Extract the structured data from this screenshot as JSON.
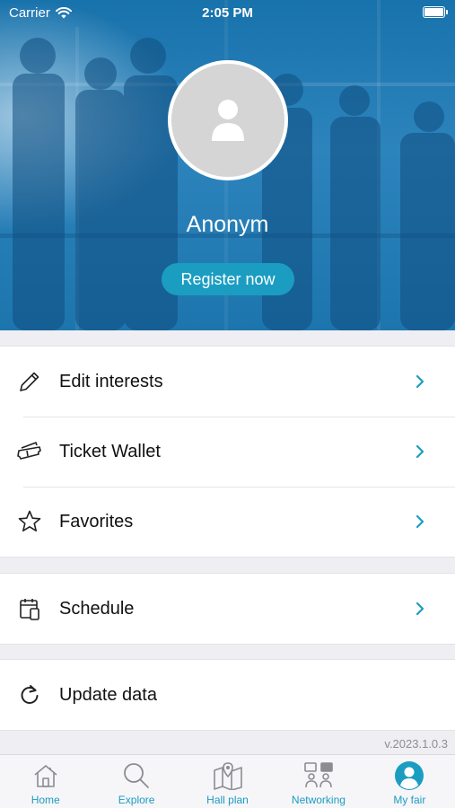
{
  "status_bar": {
    "carrier": "Carrier",
    "time": "2:05 PM"
  },
  "profile": {
    "name": "Anonym",
    "register_label": "Register now"
  },
  "menu": {
    "group1": [
      {
        "label": "Edit interests",
        "icon": "pencil-icon"
      },
      {
        "label": "Ticket Wallet",
        "icon": "ticket-icon"
      },
      {
        "label": "Favorites",
        "icon": "star-icon"
      }
    ],
    "schedule_label": "Schedule",
    "update_label": "Update data"
  },
  "version": "v.2023.1.0.3",
  "tabs": [
    {
      "label": "Home",
      "icon": "home-icon"
    },
    {
      "label": "Explore",
      "icon": "search-icon"
    },
    {
      "label": "Hall plan",
      "icon": "map-icon"
    },
    {
      "label": "Networking",
      "icon": "networking-icon"
    },
    {
      "label": "My fair",
      "icon": "profile-icon",
      "active": true
    }
  ],
  "colors": {
    "accent": "#1b9dc2",
    "header_blue": "#1d75ae"
  }
}
